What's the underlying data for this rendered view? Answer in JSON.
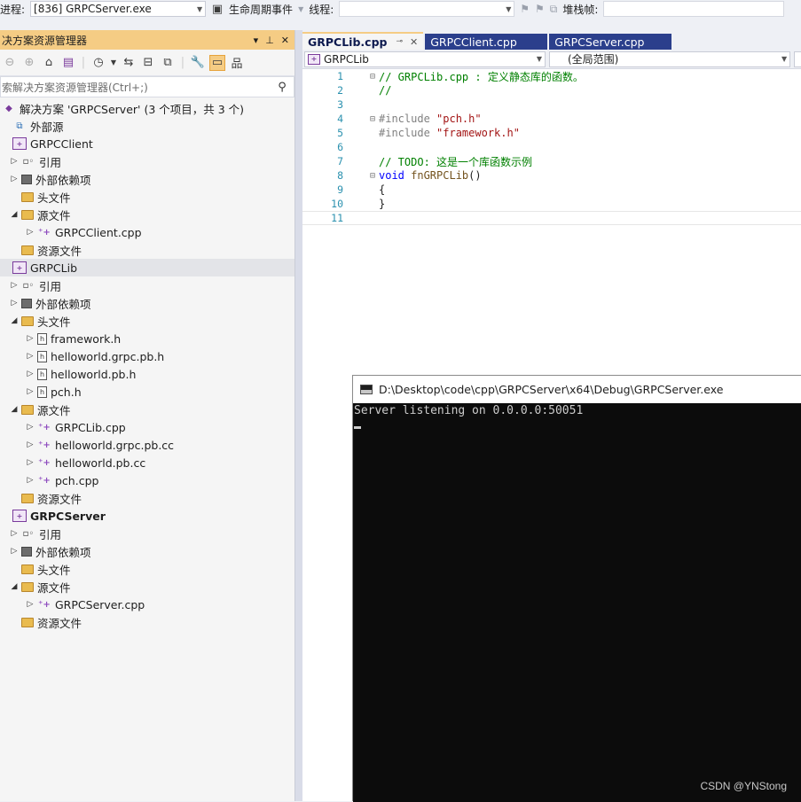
{
  "toolbar": {
    "process_label": "进程:",
    "process_value": "[836] GRPCServer.exe",
    "lifecycle_label": "生命周期事件",
    "thread_label": "线程:",
    "stackframe_label": "堆栈帧:"
  },
  "solution_explorer": {
    "title": "决方案资源管理器",
    "search_placeholder": "索解决方案资源管理器(Ctrl+;)",
    "solution_label": "解决方案 'GRPCServer' (3 个项目，共 3 个)",
    "external_sources": "外部源",
    "projects": [
      {
        "name": "GRPCClient",
        "items": [
          {
            "label": "引用",
            "kind": "ref",
            "expander": "collapsed"
          },
          {
            "label": "外部依赖项",
            "kind": "dep",
            "expander": "collapsed"
          },
          {
            "label": "头文件",
            "kind": "folder",
            "expander": "none"
          },
          {
            "label": "源文件",
            "kind": "folder",
            "expander": "expanded",
            "children": [
              {
                "label": "GRPCClient.cpp",
                "kind": "cpp"
              }
            ]
          },
          {
            "label": "资源文件",
            "kind": "folder",
            "expander": "none"
          }
        ]
      },
      {
        "name": "GRPCLib",
        "items": [
          {
            "label": "引用",
            "kind": "ref",
            "expander": "collapsed"
          },
          {
            "label": "外部依赖项",
            "kind": "dep",
            "expander": "collapsed"
          },
          {
            "label": "头文件",
            "kind": "folder",
            "expander": "expanded",
            "children": [
              {
                "label": "framework.h",
                "kind": "h"
              },
              {
                "label": "helloworld.grpc.pb.h",
                "kind": "h"
              },
              {
                "label": "helloworld.pb.h",
                "kind": "h"
              },
              {
                "label": "pch.h",
                "kind": "h"
              }
            ]
          },
          {
            "label": "源文件",
            "kind": "folder",
            "expander": "expanded",
            "children": [
              {
                "label": "GRPCLib.cpp",
                "kind": "cpp"
              },
              {
                "label": "helloworld.grpc.pb.cc",
                "kind": "cpp"
              },
              {
                "label": "helloworld.pb.cc",
                "kind": "cpp"
              },
              {
                "label": "pch.cpp",
                "kind": "cpp"
              }
            ]
          },
          {
            "label": "资源文件",
            "kind": "folder",
            "expander": "none"
          }
        ]
      },
      {
        "name": "GRPCServer",
        "items": [
          {
            "label": "引用",
            "kind": "ref",
            "expander": "collapsed"
          },
          {
            "label": "外部依赖项",
            "kind": "dep",
            "expander": "collapsed"
          },
          {
            "label": "头文件",
            "kind": "folder",
            "expander": "none"
          },
          {
            "label": "源文件",
            "kind": "folder",
            "expander": "expanded",
            "children": [
              {
                "label": "GRPCServer.cpp",
                "kind": "cpp"
              }
            ]
          },
          {
            "label": "资源文件",
            "kind": "folder",
            "expander": "none"
          }
        ]
      }
    ]
  },
  "editor": {
    "tabs": [
      "GRPCLib.cpp",
      "GRPCClient.cpp",
      "GRPCServer.cpp"
    ],
    "nav_project": "GRPCLib",
    "nav_scope": "(全局范围)",
    "code_lines": [
      {
        "num": "1",
        "parts": [
          [
            "cm",
            "// GRPCLib.cpp : 定义静态库的函数。"
          ]
        ]
      },
      {
        "num": "2",
        "parts": [
          [
            "cm",
            "//"
          ]
        ]
      },
      {
        "num": "3",
        "parts": []
      },
      {
        "num": "4",
        "parts": [
          [
            "pp",
            "#include "
          ],
          [
            "str",
            "\"pch.h\""
          ]
        ]
      },
      {
        "num": "5",
        "parts": [
          [
            "pp",
            "#include "
          ],
          [
            "str",
            "\"framework.h\""
          ]
        ]
      },
      {
        "num": "6",
        "parts": []
      },
      {
        "num": "7",
        "parts": [
          [
            "cm",
            "// TODO: 这是一个库函数示例"
          ]
        ]
      },
      {
        "num": "8",
        "parts": [
          [
            "kw",
            "void "
          ],
          [
            "fn",
            "fnGRPCLib"
          ],
          [
            "txt",
            "()"
          ]
        ]
      },
      {
        "num": "9",
        "parts": [
          [
            "txt",
            "{"
          ]
        ]
      },
      {
        "num": "10",
        "parts": [
          [
            "txt",
            "}"
          ]
        ]
      },
      {
        "num": "11",
        "parts": []
      }
    ]
  },
  "console": {
    "title": "D:\\Desktop\\code\\cpp\\GRPCServer\\x64\\Debug\\GRPCServer.exe",
    "output": "Server listening on 0.0.0.0:50051"
  },
  "watermark": "CSDN @YNStong"
}
